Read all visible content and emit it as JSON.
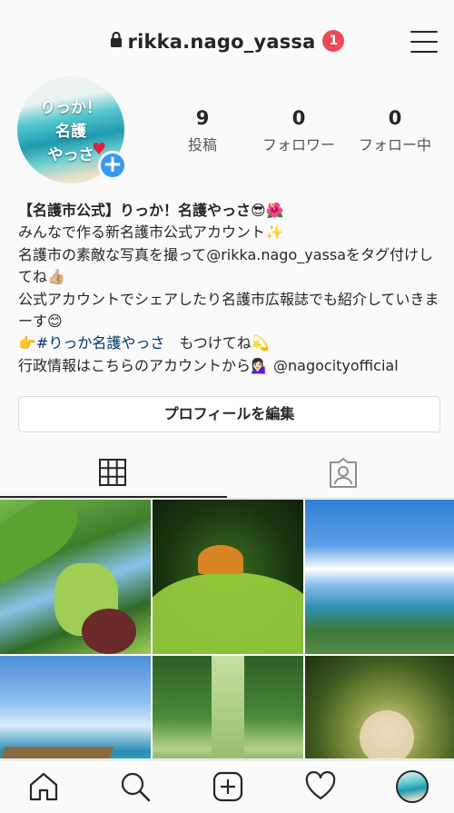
{
  "header": {
    "username": "rikka.nago_yassa",
    "notification_count": "1",
    "icons": {
      "lock": "lock-icon",
      "menu": "hamburger-menu-icon"
    }
  },
  "profile": {
    "avatar_text": {
      "line1": "りっか！",
      "line2": "名護",
      "line3": "やっさ",
      "heart": "♥"
    },
    "add_story_icon": "plus-icon",
    "add_story_glyph": "+",
    "stats": [
      {
        "value": "9",
        "label": "投稿"
      },
      {
        "value": "0",
        "label": "フォロワー"
      },
      {
        "value": "0",
        "label": "フォロー中"
      }
    ]
  },
  "bio": {
    "name": "【名護市公式】りっか！名護やっさ😎🌺",
    "lines": [
      "みんなで作る新名護市公式アカウント✨",
      "名護市の素敵な写真を撮って@rikka.nago_yassaをタグ付けしてね👍🏼",
      "公式アカウントでシェアしたり名護市広報誌でも紹介していきまーす😊"
    ],
    "hashtag_prefix": "👉",
    "hashtag": "#りっか名護やっさ",
    "hashtag_suffix": "　もつけてね💫",
    "last_line": "行政情報はこちらのアカウントから💁🏻‍♀️ @nagocityofficial"
  },
  "edit_profile_label": "プロフィールを編集",
  "tabs": [
    {
      "name": "grid",
      "icon": "grid-icon",
      "active": true
    },
    {
      "name": "tagged",
      "icon": "tagged-person-icon",
      "active": false
    }
  ],
  "bottom_nav": [
    {
      "name": "home",
      "icon": "home-icon"
    },
    {
      "name": "search",
      "icon": "search-icon"
    },
    {
      "name": "new-post",
      "icon": "add-post-icon"
    },
    {
      "name": "activity",
      "icon": "heart-icon"
    },
    {
      "name": "profile",
      "icon": "profile-avatar-icon"
    }
  ],
  "colors": {
    "notification_badge": "#ed4956",
    "add_story": "#3897f0",
    "hashtag": "#003569",
    "text": "#262626",
    "border": "#dbdbdb"
  }
}
